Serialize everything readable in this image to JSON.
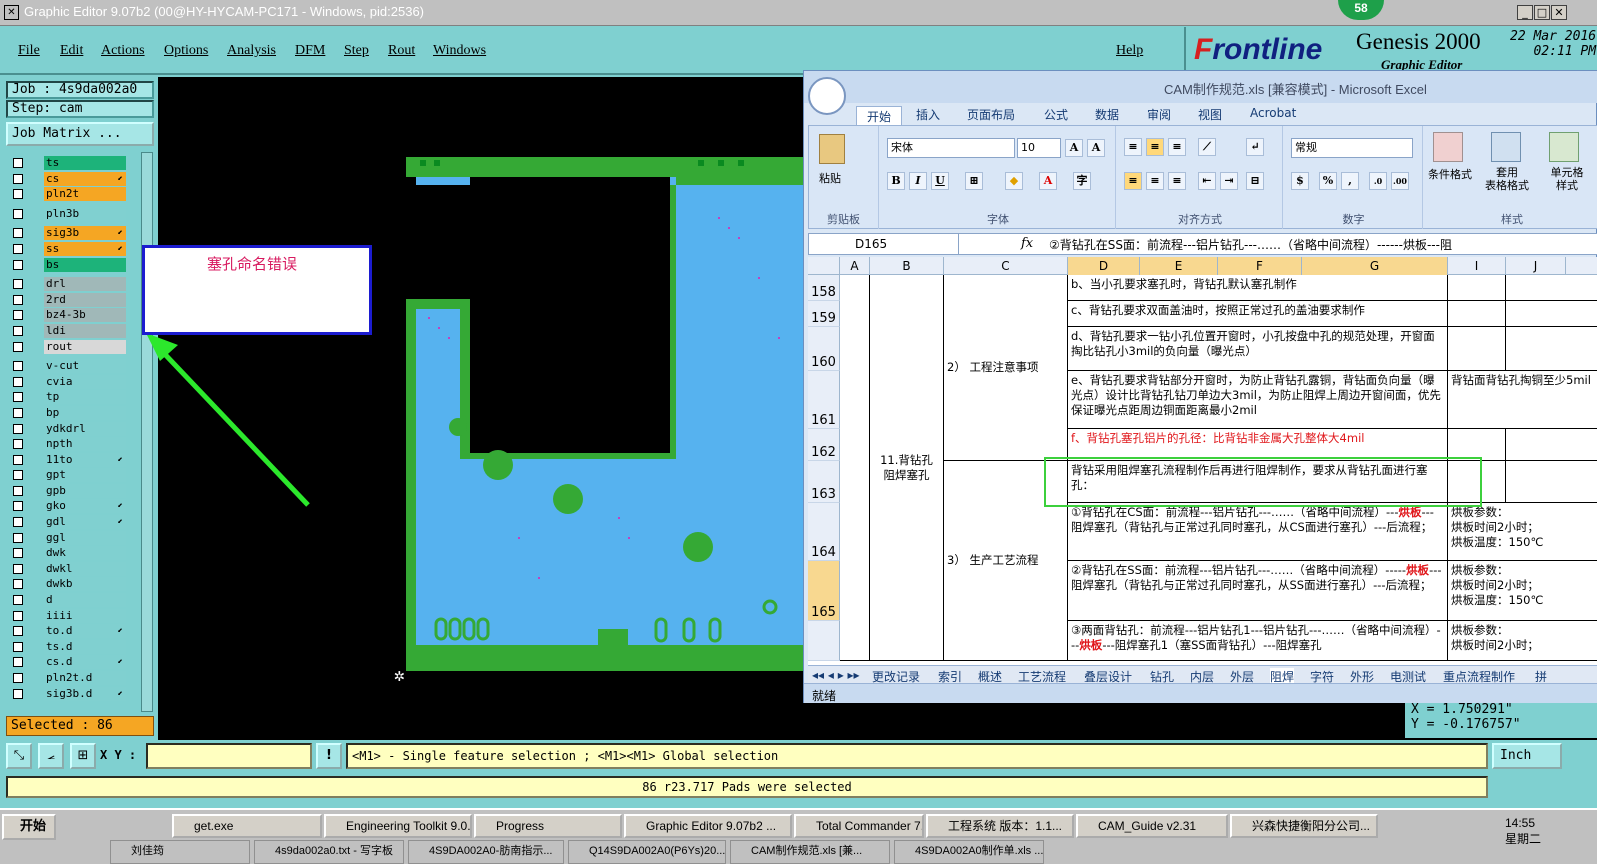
{
  "window": {
    "title": "Graphic Editor 9.07b2 (00@HY-HYCAM-PC171 - Windows, pid:2536)",
    "badge": "58"
  },
  "menu": [
    "File",
    "Edit",
    "Actions",
    "Options",
    "Analysis",
    "DFM",
    "Step",
    "Rout",
    "Windows"
  ],
  "help": "Help",
  "logo": {
    "brand_pre": "F",
    "brand": "rontline",
    "product": "Genesis 2000",
    "subtitle": "Graphic Editor",
    "date": "22 Mar 2016",
    "time": "02:11 PM"
  },
  "job": {
    "job": "Job : 4s9da002a0",
    "step": "Step: cam",
    "matrix_btn": "Job Matrix ..."
  },
  "layers": [
    {
      "name": "ts",
      "color": "#1db37a",
      "group": 1
    },
    {
      "name": "cs",
      "color": "#f5a623",
      "mark": "⬋",
      "group": 1
    },
    {
      "name": "pln2t",
      "color": "#f5a623",
      "group": 1
    },
    {
      "name": "pln3b",
      "color": "#80d0d0",
      "group": 2
    },
    {
      "name": "sig3b",
      "color": "#f5a623",
      "mark": "⬋",
      "group": 3
    },
    {
      "name": "ss",
      "color": "#f5a623",
      "mark": "⬋",
      "group": 3
    },
    {
      "name": "bs",
      "color": "#1db37a",
      "group": 3
    },
    {
      "name": "drl",
      "color": "#a0b8b8",
      "group": 4
    },
    {
      "name": "2rd",
      "color": "#a0b8b8",
      "group": 4
    },
    {
      "name": "bz4-3b",
      "color": "#a0b8b8",
      "group": 4
    },
    {
      "name": "ldi",
      "color": "#a0b8b8",
      "group": 4
    },
    {
      "name": "rout",
      "color": "#d8d8d8",
      "group": 4
    },
    {
      "name": "v-cut",
      "color": "#80d0d0",
      "group": 5
    },
    {
      "name": "cvia",
      "color": "#80d0d0",
      "group": 5
    },
    {
      "name": "tp",
      "color": "#80d0d0",
      "group": 5
    },
    {
      "name": "bp",
      "color": "#80d0d0",
      "group": 5
    },
    {
      "name": "ydkdrl",
      "color": "#80d0d0",
      "group": 5
    },
    {
      "name": "npth",
      "color": "#80d0d0",
      "group": 5
    },
    {
      "name": "11to",
      "color": "#80d0d0",
      "mark": "⬋",
      "group": 5
    },
    {
      "name": "gpt",
      "color": "#80d0d0",
      "group": 5
    },
    {
      "name": "gpb",
      "color": "#80d0d0",
      "group": 5
    },
    {
      "name": "gko",
      "color": "#80d0d0",
      "mark": "⬋",
      "group": 5
    },
    {
      "name": "gdl",
      "color": "#80d0d0",
      "mark": "⬋",
      "group": 5
    },
    {
      "name": "ggl",
      "color": "#80d0d0",
      "group": 5
    },
    {
      "name": "dwk",
      "color": "#80d0d0",
      "group": 5
    },
    {
      "name": "dwkl",
      "color": "#80d0d0",
      "group": 5
    },
    {
      "name": "dwkb",
      "color": "#80d0d0",
      "group": 5
    },
    {
      "name": "d",
      "color": "#80d0d0",
      "group": 5
    },
    {
      "name": "iiii",
      "color": "#80d0d0",
      "group": 5
    },
    {
      "name": "to.d",
      "color": "#80d0d0",
      "mark": "⬋",
      "group": 5
    },
    {
      "name": "ts.d",
      "color": "#80d0d0",
      "group": 5
    },
    {
      "name": "cs.d",
      "color": "#80d0d0",
      "mark": "⬋",
      "group": 5
    },
    {
      "name": "pln2t.d",
      "color": "#80d0d0",
      "group": 5
    },
    {
      "name": "sig3b.d",
      "color": "#80d0d0",
      "mark": "⬋",
      "group": 5
    }
  ],
  "selected": "Selected : 86",
  "callout": "塞孔命名错误",
  "coords": {
    "x": "X = 1.750291\"",
    "y": "Y = -0.176757\""
  },
  "excel": {
    "title": "CAM制作规范.xls  [兼容模式] - Microsoft Excel",
    "tabs": [
      "开始",
      "插入",
      "页面布局",
      "公式",
      "数据",
      "审阅",
      "视图",
      "Acrobat"
    ],
    "groups": {
      "clipboard": "剪贴板",
      "paste": "粘贴",
      "font": "字体",
      "align": "对齐方式",
      "number": "数字",
      "styles": "样式",
      "cond": "条件格式",
      "table": "套用\n表格格式",
      "cellstyle": "单元格\n样式"
    },
    "font_name": "宋体",
    "font_size": "10",
    "number_fmt": "常规",
    "namebox": "D165",
    "formula": "②背钻孔在SS面：前流程---铝片钻孔---……（省略中间流程）------烘板---阻",
    "cols": [
      "A",
      "B",
      "C",
      "D",
      "E",
      "F",
      "G",
      "I",
      "J"
    ],
    "rows": [
      {
        "num": "158",
        "text": "b、当小孔要求塞孔时，背钻孔默认塞孔制作"
      },
      {
        "num": "159",
        "text": "c、背钻孔要求双面盖油时，按照正常过孔的盖油要求制作"
      },
      {
        "num": "160",
        "text": "d、背钻孔要求一钻小孔位置开窗时，小孔按盘中孔的规范处理，开窗面掏比钻孔小3mil的负向量（曝光点）"
      },
      {
        "num": "161",
        "text": "e、背钻孔要求背钻部分开窗时，为防止背钻孔露铜，背钻面负向量（曝光点）设计比背钻孔钻刀单边大3mil，为防止阻焊上周边开窗间面，优先保证曝光点距周边铜面距离最小2mil",
        "extra": "背钻面背钻孔掏铜至少5mil"
      },
      {
        "num": "162",
        "text": "f、背钻孔塞孔铝片的孔径：比背钻非金属大孔整体大4mil"
      },
      {
        "num": "163",
        "text": "背钻采用阻焊塞孔流程制作后再进行阻焊制作，要求从背钻孔面进行塞孔："
      },
      {
        "num": "164",
        "pre": "①背钻孔在CS面：前流程---铝片钻孔---……（省略中间流程）---",
        "red": "烘板",
        "post": "---阻焊塞孔（背钻孔与正常过孔同时塞孔，从CS面进行塞孔）---后流程；",
        "extra": "烘板参数：\n烘板时间2小时；\n烘板温度：150℃"
      },
      {
        "num": "165",
        "pre": "②背钻孔在SS面：前流程---铝片钻孔---……（省略中间流程）-----",
        "red": "烘板",
        "post": "---阻焊塞孔（背钻孔与正常过孔同时塞孔，从SS面进行塞孔）---后流程；",
        "extra": "烘板参数：\n烘板时间2小时；\n烘板温度：150℃"
      },
      {
        "num": "",
        "pre": "③两面背钻孔：前流程---铝片钻孔1---铝片钻孔---……（省略中间流程）---",
        "red": "烘板",
        "post": "---阻焊塞孔1（塞SS面背钻孔）---阻焊塞孔",
        "extra": "烘板参数：\n烘板时间2小时；"
      }
    ],
    "b_label": "11.背钻孔\n阻焊塞孔",
    "c2": "2） 工程注意事项",
    "c3": "3） 生产工艺流程",
    "sheets": [
      "更改记录",
      "索引",
      "概述",
      "工艺流程",
      "叠层设计",
      "钻孔",
      "内层",
      "外层",
      "阻焊",
      "字符",
      "外形",
      "电测试",
      "重点流程制作",
      "拼"
    ],
    "status": "就绪"
  },
  "bottom": {
    "xy_label": "X Y :",
    "message": "<M1> - Single feature selection ; <M1><M1> Global selection",
    "unit": "Inch",
    "pads": "86 r23.717 Pads were selected"
  },
  "taskbar": {
    "start": "开始",
    "row1": [
      "get.exe",
      "Engineering Toolkit 9.0...",
      "Progress",
      "Graphic Editor 9.07b2 ...",
      "Total Commander 7.0 ...",
      "工程系统  版本：1.1...",
      "CAM_Guide v2.31",
      "兴森快捷衡阳分公司..."
    ],
    "row2": [
      "刘佳筠",
      "4s9da002a0.txt - 写字板",
      "4S9DA002A0-肪南指示...",
      "Q14S9DA002A0(P6Ys)20...",
      "CAM制作规范.xls [兼...",
      "4S9DA002A0制作单.xls ..."
    ],
    "clock": "14:55",
    "day": "星期二"
  }
}
